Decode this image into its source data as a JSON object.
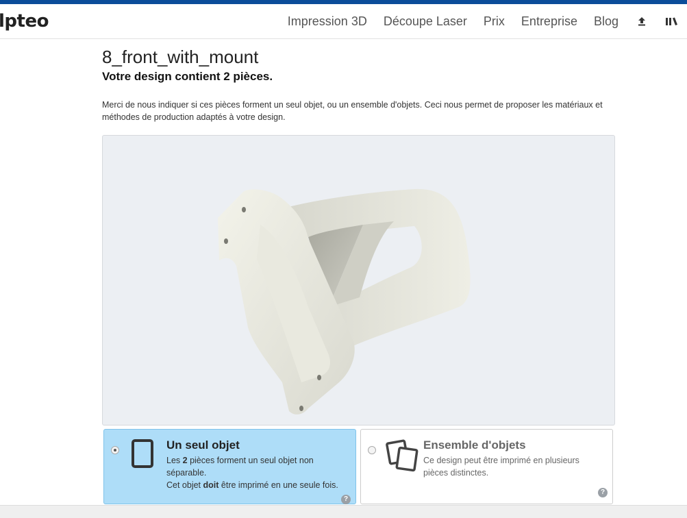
{
  "header": {
    "logo": "lpteo",
    "nav": [
      "Impression 3D",
      "Découpe Laser",
      "Prix",
      "Entreprise",
      "Blog"
    ],
    "icons": [
      "upload-icon",
      "library-icon"
    ]
  },
  "design": {
    "name": "8_front_with_mount",
    "subtitle": "Votre design contient 2 pièces.",
    "description": "Merci de nous indiquer si ces pièces forment un seul objet, ou un ensemble d'objets. Ceci nous permet de proposer les matériaux et méthodes de production adaptés à votre design."
  },
  "viewer": {
    "background": "#eceff3",
    "model_color": "#e6e6dc"
  },
  "options": {
    "single": {
      "title": "Un seul objet",
      "line1_pre": "Les ",
      "line1_bold": "2",
      "line1_post": " pièces forment un seul objet non séparable.",
      "line2_pre": "Cet objet ",
      "line2_bold": "doit",
      "line2_post": " être imprimé en une seule fois.",
      "selected": true
    },
    "multiple": {
      "title": "Ensemble d'objets",
      "text": "Ce design peut être imprimé en plusieurs pièces distinctes.",
      "selected": false
    },
    "help_glyph": "?"
  },
  "colors": {
    "accent": "#0b4d9a",
    "selected_bg": "#aeddf8"
  }
}
